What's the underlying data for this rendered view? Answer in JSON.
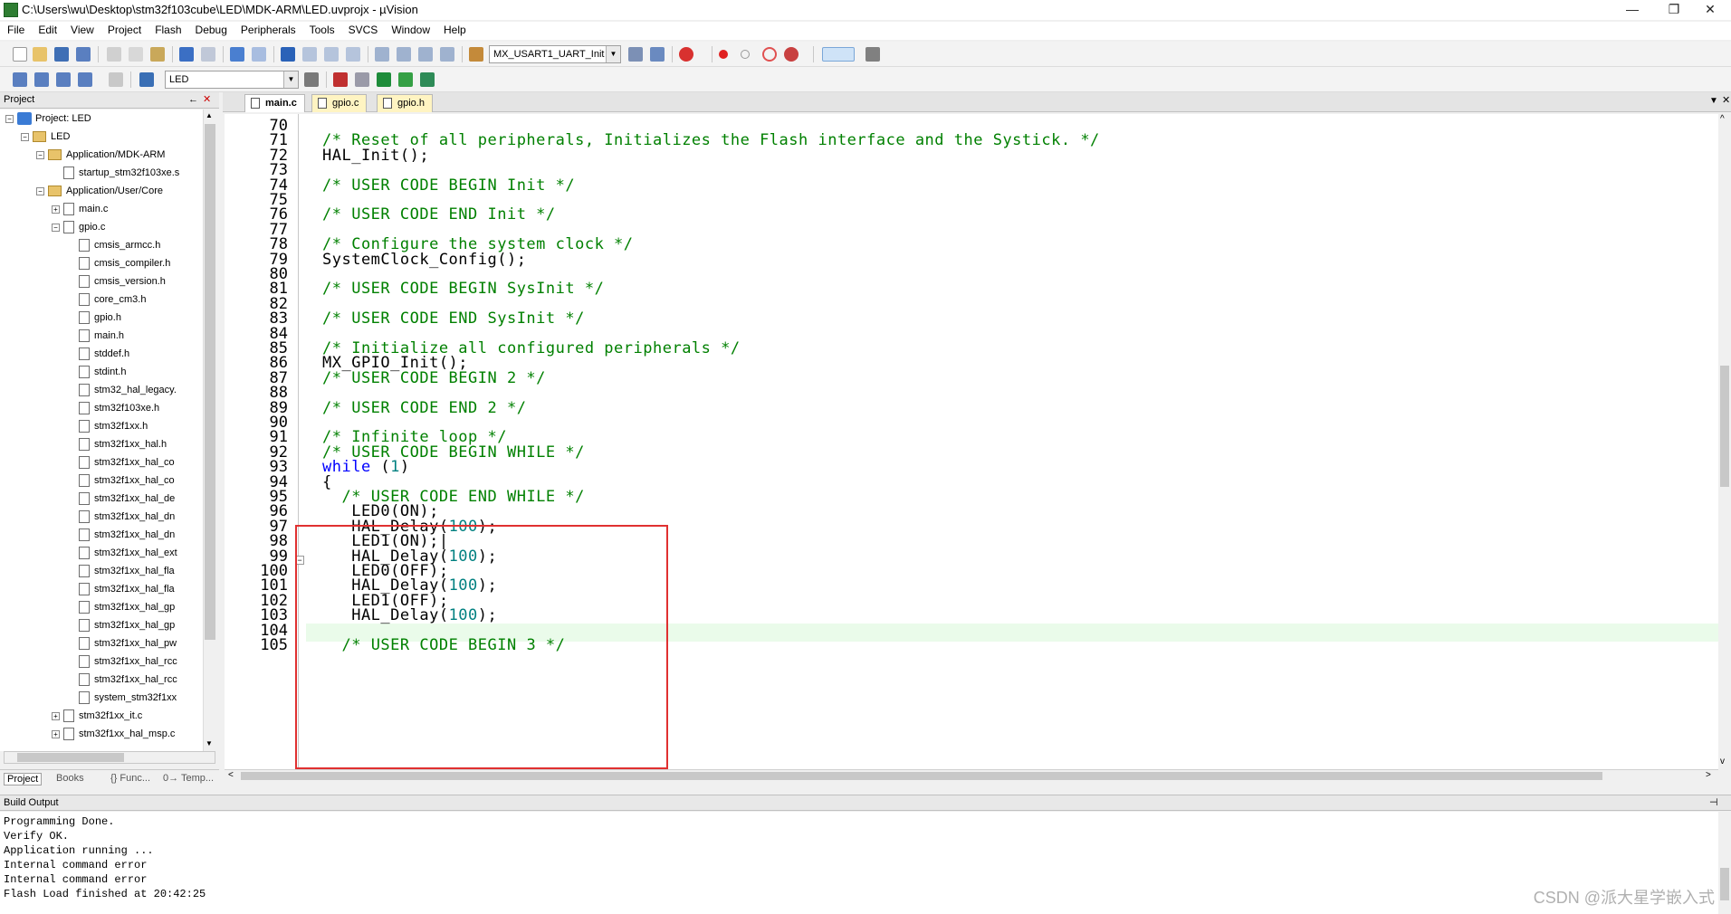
{
  "window": {
    "title": "C:\\Users\\wu\\Desktop\\stm32f103cube\\LED\\MDK-ARM\\LED.uvprojx - µVision",
    "minimize": "—",
    "restore": "❐",
    "close": "✕"
  },
  "menu": [
    "File",
    "Edit",
    "View",
    "Project",
    "Flash",
    "Debug",
    "Peripherals",
    "Tools",
    "SVCS",
    "Window",
    "Help"
  ],
  "toolbar": {
    "target_combo": "MX_USART1_UART_Init",
    "build_target": "LED"
  },
  "project_panel": {
    "title": "Project",
    "pin": "←",
    "close": "✕",
    "tree": [
      {
        "label": "Project: LED",
        "level": 0,
        "kind": "project",
        "exp": "−"
      },
      {
        "label": "LED",
        "level": 1,
        "kind": "target",
        "exp": "−"
      },
      {
        "label": "Application/MDK-ARM",
        "level": 2,
        "kind": "folder",
        "exp": "−"
      },
      {
        "label": "startup_stm32f103xe.s",
        "level": 3,
        "kind": "file",
        "exp": ""
      },
      {
        "label": "Application/User/Core",
        "level": 2,
        "kind": "folder",
        "exp": "−"
      },
      {
        "label": "main.c",
        "level": 3,
        "kind": "file",
        "exp": "+"
      },
      {
        "label": "gpio.c",
        "level": 3,
        "kind": "file",
        "exp": "−"
      },
      {
        "label": "cmsis_armcc.h",
        "level": 4,
        "kind": "file",
        "exp": ""
      },
      {
        "label": "cmsis_compiler.h",
        "level": 4,
        "kind": "file",
        "exp": ""
      },
      {
        "label": "cmsis_version.h",
        "level": 4,
        "kind": "file",
        "exp": ""
      },
      {
        "label": "core_cm3.h",
        "level": 4,
        "kind": "file",
        "exp": ""
      },
      {
        "label": "gpio.h",
        "level": 4,
        "kind": "file",
        "exp": ""
      },
      {
        "label": "main.h",
        "level": 4,
        "kind": "file",
        "exp": ""
      },
      {
        "label": "stddef.h",
        "level": 4,
        "kind": "file",
        "exp": ""
      },
      {
        "label": "stdint.h",
        "level": 4,
        "kind": "file",
        "exp": ""
      },
      {
        "label": "stm32_hal_legacy.",
        "level": 4,
        "kind": "file",
        "exp": ""
      },
      {
        "label": "stm32f103xe.h",
        "level": 4,
        "kind": "file",
        "exp": ""
      },
      {
        "label": "stm32f1xx.h",
        "level": 4,
        "kind": "file",
        "exp": ""
      },
      {
        "label": "stm32f1xx_hal.h",
        "level": 4,
        "kind": "file",
        "exp": ""
      },
      {
        "label": "stm32f1xx_hal_co",
        "level": 4,
        "kind": "file",
        "exp": ""
      },
      {
        "label": "stm32f1xx_hal_co",
        "level": 4,
        "kind": "file",
        "exp": ""
      },
      {
        "label": "stm32f1xx_hal_de",
        "level": 4,
        "kind": "file",
        "exp": ""
      },
      {
        "label": "stm32f1xx_hal_dn",
        "level": 4,
        "kind": "file",
        "exp": ""
      },
      {
        "label": "stm32f1xx_hal_dn",
        "level": 4,
        "kind": "file",
        "exp": ""
      },
      {
        "label": "stm32f1xx_hal_ext",
        "level": 4,
        "kind": "file",
        "exp": ""
      },
      {
        "label": "stm32f1xx_hal_fla",
        "level": 4,
        "kind": "file",
        "exp": ""
      },
      {
        "label": "stm32f1xx_hal_fla",
        "level": 4,
        "kind": "file",
        "exp": ""
      },
      {
        "label": "stm32f1xx_hal_gp",
        "level": 4,
        "kind": "file",
        "exp": ""
      },
      {
        "label": "stm32f1xx_hal_gp",
        "level": 4,
        "kind": "file",
        "exp": ""
      },
      {
        "label": "stm32f1xx_hal_pw",
        "level": 4,
        "kind": "file",
        "exp": ""
      },
      {
        "label": "stm32f1xx_hal_rcc",
        "level": 4,
        "kind": "file",
        "exp": ""
      },
      {
        "label": "stm32f1xx_hal_rcc",
        "level": 4,
        "kind": "file",
        "exp": ""
      },
      {
        "label": "system_stm32f1xx",
        "level": 4,
        "kind": "file",
        "exp": ""
      },
      {
        "label": "stm32f1xx_it.c",
        "level": 3,
        "kind": "file",
        "exp": "+"
      },
      {
        "label": "stm32f1xx_hal_msp.c",
        "level": 3,
        "kind": "file",
        "exp": "+"
      }
    ],
    "tabs": [
      "Project",
      "Books",
      "{} Func...",
      "0→ Temp..."
    ]
  },
  "editor": {
    "tabs": [
      {
        "label": "main.c",
        "active": true
      },
      {
        "label": "gpio.c",
        "active": false
      },
      {
        "label": "gpio.h",
        "active": false
      }
    ],
    "lines": [
      {
        "n": "70",
        "html": ""
      },
      {
        "n": "71",
        "html": "<span class='cm'>/* Reset of all peripherals, Initializes the Flash interface and the Systick. */</span>"
      },
      {
        "n": "72",
        "html": "HAL_Init();"
      },
      {
        "n": "73",
        "html": ""
      },
      {
        "n": "74",
        "html": "<span class='cm'>/* USER CODE BEGIN Init */</span>"
      },
      {
        "n": "75",
        "html": ""
      },
      {
        "n": "76",
        "html": "<span class='cm'>/* USER CODE END Init */</span>"
      },
      {
        "n": "77",
        "html": ""
      },
      {
        "n": "78",
        "html": "<span class='cm'>/* Configure the system clock */</span>"
      },
      {
        "n": "79",
        "html": "SystemClock_Config();"
      },
      {
        "n": "80",
        "html": ""
      },
      {
        "n": "81",
        "html": "<span class='cm'>/* USER CODE BEGIN SysInit */</span>"
      },
      {
        "n": "82",
        "html": ""
      },
      {
        "n": "83",
        "html": "<span class='cm'>/* USER CODE END SysInit */</span>"
      },
      {
        "n": "84",
        "html": ""
      },
      {
        "n": "85",
        "html": "<span class='cm'>/* Initialize all configured peripherals */</span>"
      },
      {
        "n": "86",
        "html": "MX_GPIO_Init();"
      },
      {
        "n": "87",
        "html": "<span class='cm'>/* USER CODE BEGIN 2 */</span>"
      },
      {
        "n": "88",
        "html": ""
      },
      {
        "n": "89",
        "html": "<span class='cm'>/* USER CODE END 2 */</span>"
      },
      {
        "n": "90",
        "html": ""
      },
      {
        "n": "91",
        "html": "<span class='cm'>/* Infinite loop */</span>"
      },
      {
        "n": "92",
        "html": "<span class='cm'>/* USER CODE BEGIN WHILE */</span>"
      },
      {
        "n": "93",
        "html": "<span class='kw'>while</span> (<span class='num'>1</span>)"
      },
      {
        "n": "94",
        "html": "{"
      },
      {
        "n": "95",
        "html": "  <span class='cm'>/* USER CODE END WHILE */</span>"
      },
      {
        "n": "96",
        "html": "   LED0(ON);"
      },
      {
        "n": "97",
        "html": "   HAL_Delay(<span class='num'>100</span>);"
      },
      {
        "n": "98",
        "html": "   LED1(ON);|"
      },
      {
        "n": "99",
        "html": "   HAL_Delay(<span class='num'>100</span>);"
      },
      {
        "n": "100",
        "html": "   LED0(OFF);"
      },
      {
        "n": "101",
        "html": "   HAL_Delay(<span class='num'>100</span>);"
      },
      {
        "n": "102",
        "html": "   LED1(OFF);"
      },
      {
        "n": "103",
        "html": "   HAL_Delay(<span class='num'>100</span>);"
      },
      {
        "n": "104",
        "html": ""
      },
      {
        "n": "105",
        "html": "  <span class='cm'>/* USER CODE BEGIN 3 */</span>"
      }
    ]
  },
  "build_output": {
    "title": "Build Output",
    "lines": [
      "Programming Done.",
      "Verify OK.",
      "Application running ...",
      "Internal command error",
      "Internal command error",
      "Flash Load finished at 20:42:25"
    ]
  },
  "watermark": "CSDN @派大星学嵌入式",
  "colors": {
    "comment": "#008000",
    "keyword": "#0000ff",
    "number": "#008080",
    "highlight_box": "#e03030"
  }
}
